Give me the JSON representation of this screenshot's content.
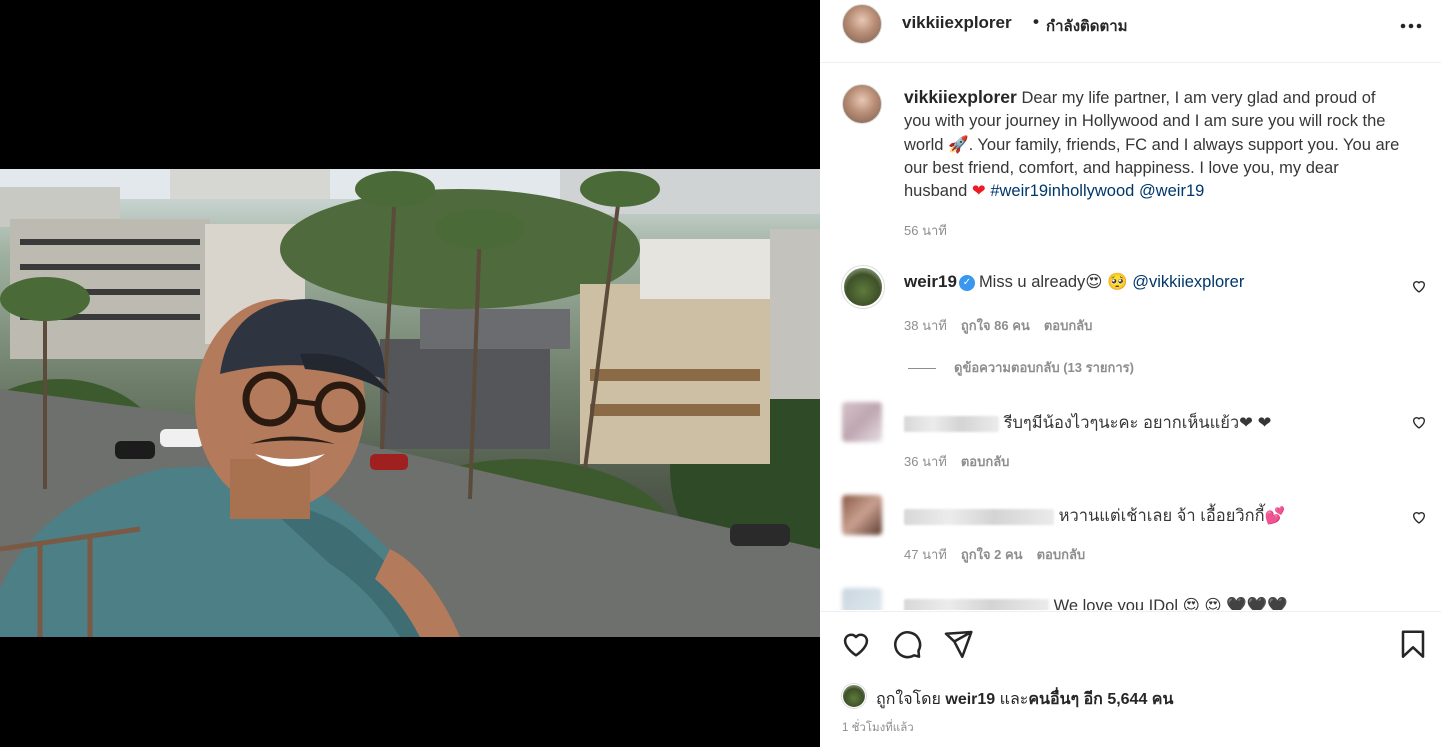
{
  "header": {
    "username": "vikkiiexplorer",
    "separator": "•",
    "follow_status": "กำลังติดตาม",
    "more_icon": "more-horizontal-icon"
  },
  "caption": {
    "username": "vikkiiexplorer",
    "text_part1": "Dear my life partner, I am very glad and proud of you with your journey in Hollywood and I am sure you will rock the world ",
    "rocket": "🚀",
    "text_part2": ". Your family, friends, FC and I always support you. You are our best friend, comfort, and happiness. I love you, my dear husband ",
    "heart": "❤",
    "hashtag": "#weir19inhollywood",
    "mention": "@weir19",
    "time": "56 นาที"
  },
  "comments": [
    {
      "username": "weir19",
      "verified": true,
      "text": "Miss u already😍 🥺 ",
      "mention": "@vikkiiexplorer",
      "time": "38 นาที",
      "likes": "ถูกใจ 86 คน",
      "reply": "ตอบกลับ"
    },
    {
      "username_blurred": true,
      "text": "รีบๆมีน้องไวๆนะคะ อยากเห็นแย้ว❤ ❤",
      "time": "36 นาที",
      "reply": "ตอบกลับ"
    },
    {
      "username_blurred": true,
      "text": "หวานแต่เช้าเลย จ้า เอื้อยวิกกี้💕",
      "time": "47 นาที",
      "likes": "ถูกใจ 2 คน",
      "reply": "ตอบกลับ"
    },
    {
      "username_blurred": true,
      "text": "We love you IDol 😍 😍 🖤🖤🖤"
    }
  ],
  "view_replies": "ดูข้อความตอบกลับ (13 รายการ)",
  "actions": {
    "like_icon": "heart-outline-icon",
    "comment_icon": "comment-icon",
    "share_icon": "send-icon",
    "save_icon": "bookmark-icon"
  },
  "likes": {
    "prefix": "ถูกใจโดย ",
    "user": "weir19",
    "middle": " และ",
    "others": "คนอื่นๆ อีก 5,644 คน"
  },
  "post_time": "1 ชั่วโมงที่แล้ว"
}
